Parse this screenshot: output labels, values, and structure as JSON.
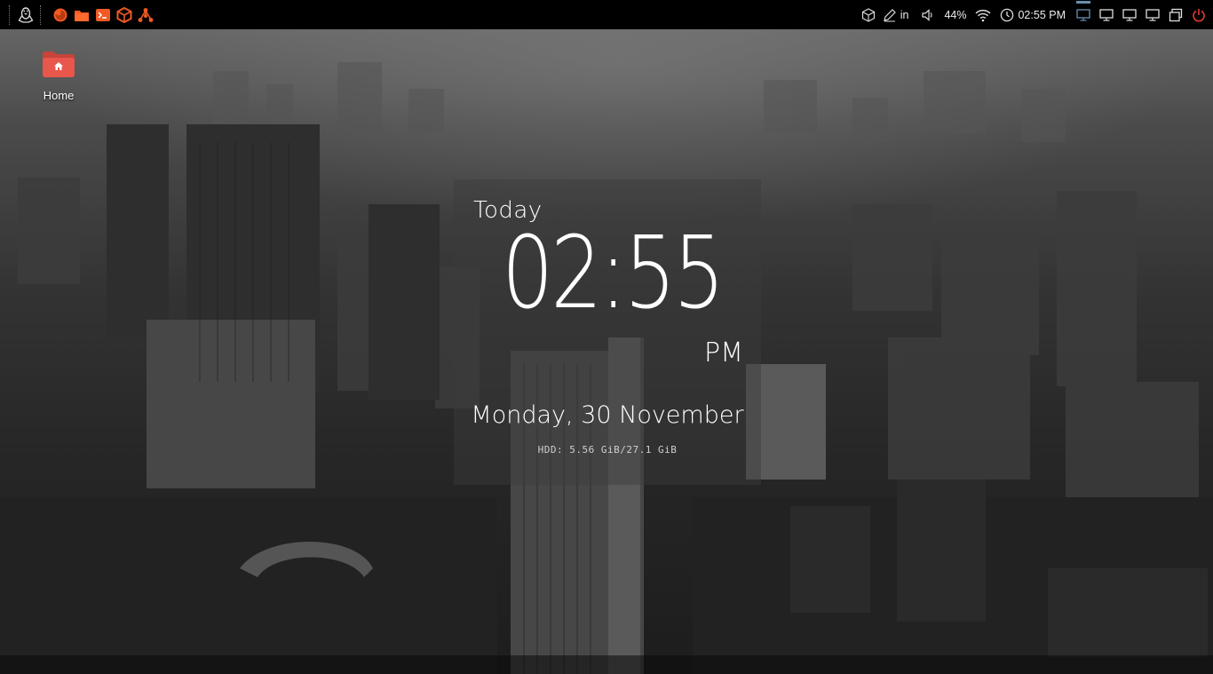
{
  "panel": {
    "launchers": [
      {
        "icon": "firefox-icon"
      },
      {
        "icon": "folder-icon"
      },
      {
        "icon": "terminal-icon"
      },
      {
        "icon": "package-icon"
      },
      {
        "icon": "network-share-icon"
      }
    ],
    "tray": {
      "keyboard_layout": "in",
      "volume_percent": "44%",
      "clock_text": "02:55 PM"
    },
    "workspaces": [
      "Workspace 1",
      "Workspace 2",
      "Workspace 3",
      "Workspace 4"
    ],
    "accent_color": "#f05a23",
    "power_color": "#e03a2f"
  },
  "desktop": {
    "home_label": "Home",
    "folder_color": "#e9564b"
  },
  "clock_widget": {
    "heading": "Today",
    "time": "02:55",
    "ampm": "PM",
    "date": "Monday, 30 November",
    "hdd": "HDD: 5.56 GiB/27.1 GiB"
  }
}
